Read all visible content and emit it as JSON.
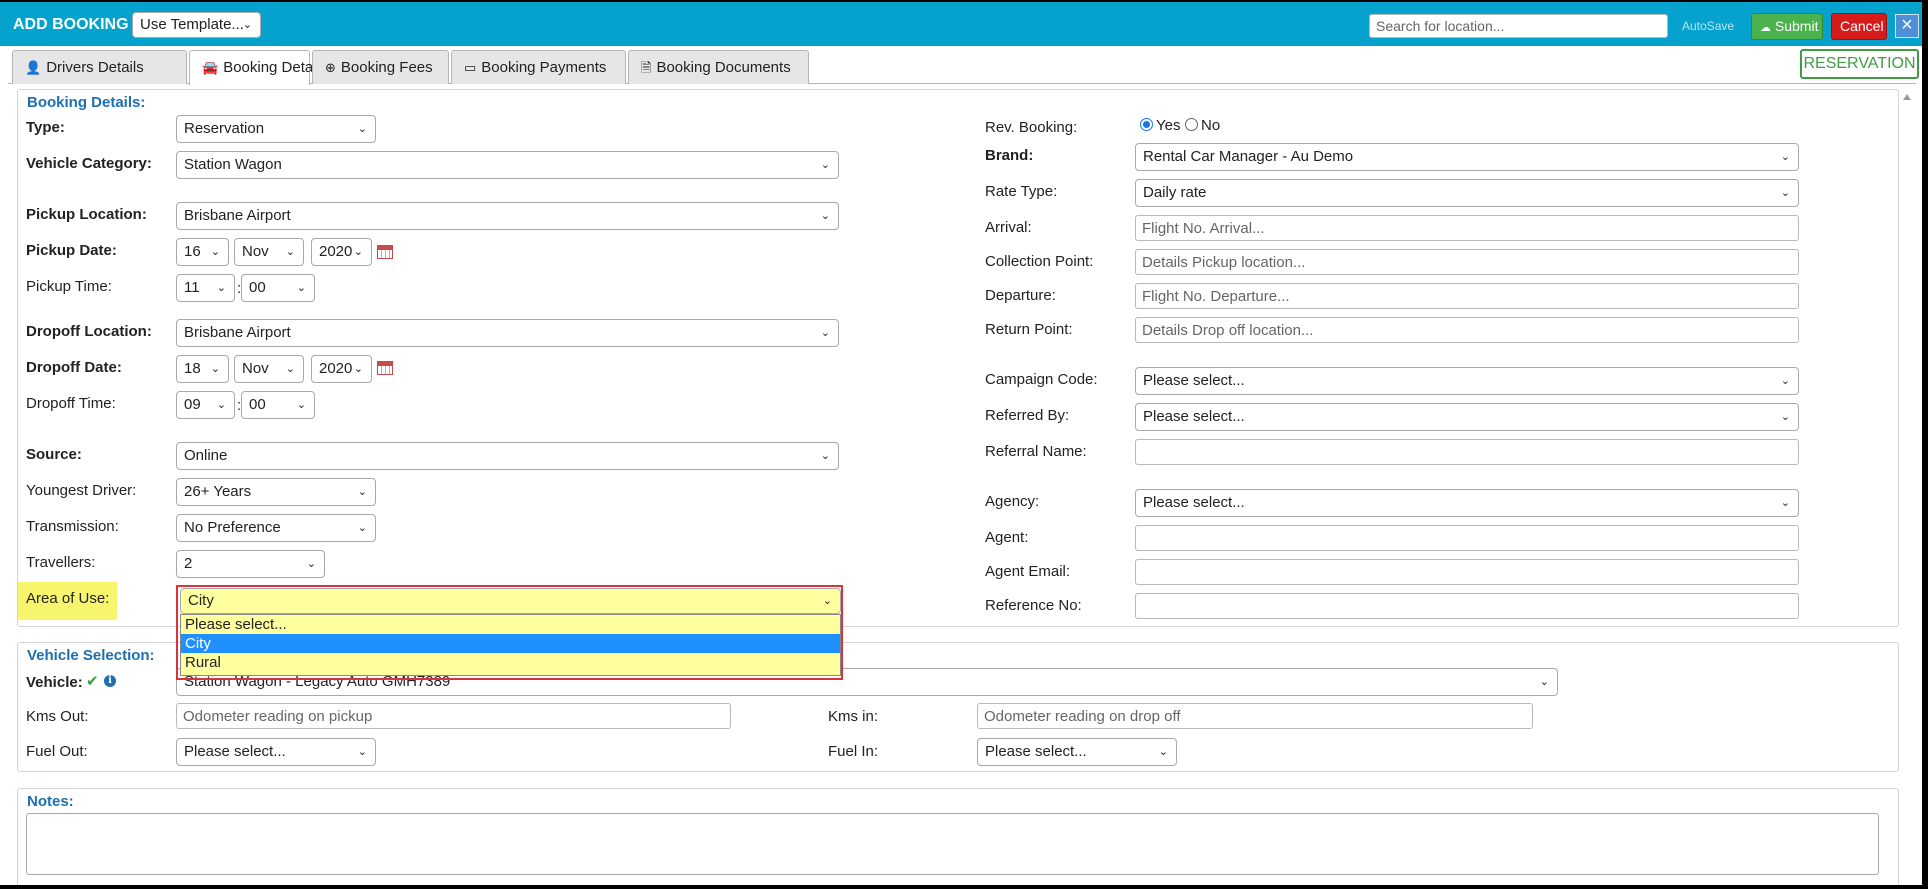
{
  "topbar": {
    "title": "ADD BOOKING",
    "template_select": "Use Template...",
    "search_placeholder": "Search for location...",
    "autosave": "AutoSave",
    "submit": "Submit",
    "cancel": "Cancel",
    "close": "×",
    "color": "#04a2cd"
  },
  "tabs": [
    {
      "label": "Drivers Details",
      "icon": "user-icon",
      "glyph": "👤"
    },
    {
      "label": "Booking Details",
      "icon": "car-icon",
      "glyph": "🚘"
    },
    {
      "label": "Booking Fees",
      "icon": "plus-circle-icon",
      "glyph": "⊕"
    },
    {
      "label": "Booking Payments",
      "icon": "credit-card-icon",
      "glyph": "▭"
    },
    {
      "label": "Booking Documents",
      "icon": "document-icon",
      "glyph": "🗎"
    }
  ],
  "status_badge": "RESERVATION",
  "booking_details": {
    "legend": "Booking Details:",
    "type": {
      "label": "Type:",
      "value": "Reservation"
    },
    "vehicle_category": {
      "label": "Vehicle Category:",
      "value": "Station Wagon"
    },
    "pickup_location": {
      "label": "Pickup Location:",
      "value": "Brisbane Airport"
    },
    "pickup_date": {
      "label": "Pickup Date:",
      "day": "16",
      "month": "Nov",
      "year": "2020"
    },
    "pickup_time": {
      "label": "Pickup Time:",
      "hour": "11",
      "minute": "00"
    },
    "dropoff_location": {
      "label": "Dropoff Location:",
      "value": "Brisbane Airport"
    },
    "dropoff_date": {
      "label": "Dropoff Date:",
      "day": "18",
      "month": "Nov",
      "year": "2020"
    },
    "dropoff_time": {
      "label": "Dropoff Time:",
      "hour": "09",
      "minute": "00"
    },
    "source": {
      "label": "Source:",
      "value": "Online"
    },
    "youngest_driver": {
      "label": "Youngest Driver:",
      "value": "26+ Years"
    },
    "transmission": {
      "label": "Transmission:",
      "value": "No Preference"
    },
    "travellers": {
      "label": "Travellers:",
      "value": "2"
    },
    "area_of_use": {
      "label": "Area of Use:",
      "value": "City",
      "options": [
        "Please select...",
        "City",
        "Rural"
      ],
      "selected_index": 1
    },
    "rev_booking": {
      "label": "Rev. Booking:",
      "yes": "Yes",
      "no": "No",
      "selected": "Yes"
    },
    "brand": {
      "label": "Brand:",
      "value": "Rental Car Manager - Au Demo"
    },
    "rate_type": {
      "label": "Rate Type:",
      "value": "Daily rate"
    },
    "arrival": {
      "label": "Arrival:",
      "placeholder": "Flight No. Arrival..."
    },
    "collection_point": {
      "label": "Collection Point:",
      "placeholder": "Details Pickup location..."
    },
    "departure": {
      "label": "Departure:",
      "placeholder": "Flight No. Departure..."
    },
    "return_point": {
      "label": "Return Point:",
      "placeholder": "Details Drop off location..."
    },
    "campaign_code": {
      "label": "Campaign Code:",
      "value": "Please select..."
    },
    "referred_by": {
      "label": "Referred By:",
      "value": "Please select..."
    },
    "referral_name": {
      "label": "Referral Name:"
    },
    "agency": {
      "label": "Agency:",
      "value": "Please select..."
    },
    "agent": {
      "label": "Agent:"
    },
    "agent_email": {
      "label": "Agent Email:"
    },
    "reference_no": {
      "label": "Reference No:"
    }
  },
  "vehicle_selection": {
    "legend": "Vehicle Selection:",
    "vehicle": {
      "label": "Vehicle:",
      "value": "Station Wagon - Legacy Auto GMH7389"
    },
    "kms_out": {
      "label": "Kms Out:",
      "placeholder": "Odometer reading on pickup"
    },
    "kms_in": {
      "label": "Kms in:",
      "placeholder": "Odometer reading on drop off"
    },
    "fuel_out": {
      "label": "Fuel Out:",
      "value": "Please select..."
    },
    "fuel_in": {
      "label": "Fuel In:",
      "value": "Please select..."
    }
  },
  "notes": {
    "legend": "Notes:"
  }
}
